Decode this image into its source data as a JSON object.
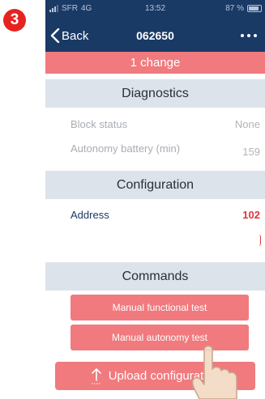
{
  "step": {
    "number": "3"
  },
  "status_bar": {
    "carrier": "SFR",
    "network": "4G",
    "time": "13:52",
    "battery": "87 %"
  },
  "nav": {
    "back_label": "Back",
    "title": "062650",
    "more_icon": "more-icon"
  },
  "change_banner": {
    "text": "1 change"
  },
  "diagnostics": {
    "header": "Diagnostics",
    "rows": [
      {
        "label": "Block status",
        "value": "None"
      },
      {
        "label": "Autonomy battery (min)",
        "value": "159"
      }
    ]
  },
  "configuration": {
    "header": "Configuration",
    "address_label": "Address",
    "address_value": "102"
  },
  "commands": {
    "header": "Commands",
    "buttons": [
      "Manual functional test",
      "Manual autonomy test"
    ]
  },
  "upload": {
    "label": "Upload configuration"
  },
  "colors": {
    "navy": "#1a3a66",
    "accent": "#f07a7d",
    "section_bg": "#dde3ea",
    "badge": "#e52421",
    "value_red": "#e0353a"
  }
}
